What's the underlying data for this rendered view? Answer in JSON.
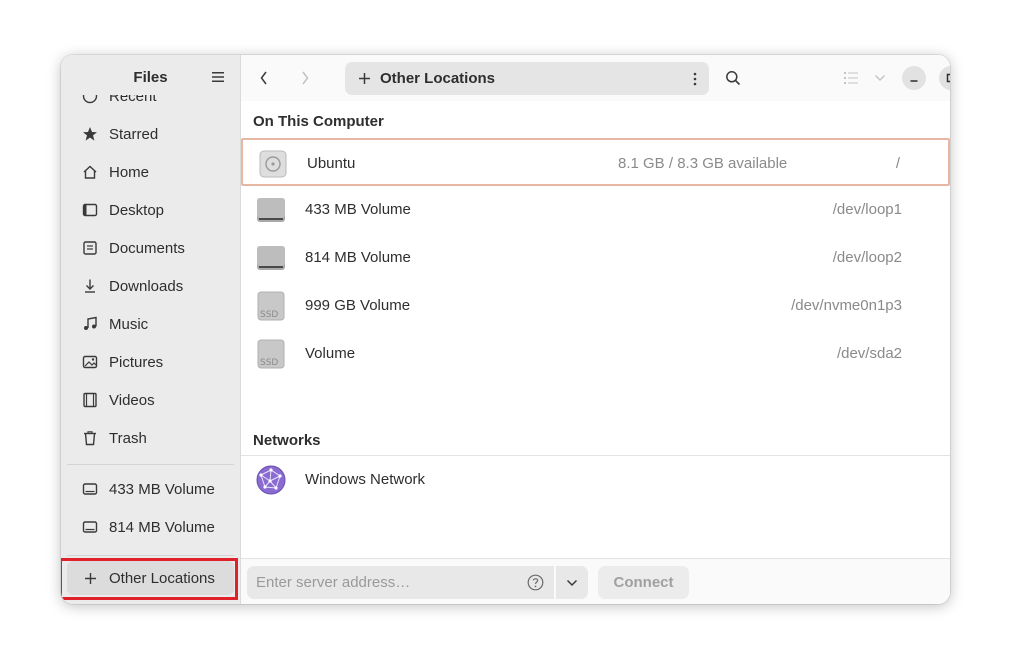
{
  "sidebar": {
    "title": "Files",
    "partial_top_item": "Recent",
    "items": [
      {
        "label": "Starred",
        "icon": "star-icon"
      },
      {
        "label": "Home",
        "icon": "home-icon"
      },
      {
        "label": "Desktop",
        "icon": "desktop-icon"
      },
      {
        "label": "Documents",
        "icon": "documents-icon"
      },
      {
        "label": "Downloads",
        "icon": "downloads-icon"
      },
      {
        "label": "Music",
        "icon": "music-icon"
      },
      {
        "label": "Pictures",
        "icon": "pictures-icon"
      },
      {
        "label": "Videos",
        "icon": "videos-icon"
      },
      {
        "label": "Trash",
        "icon": "trash-icon"
      }
    ],
    "volumes": [
      {
        "label": "433 MB Volume",
        "icon": "drive-icon"
      },
      {
        "label": "814 MB Volume",
        "icon": "drive-icon"
      }
    ],
    "other_locations": "Other Locations"
  },
  "header": {
    "path_label": "Other Locations"
  },
  "content": {
    "on_this_computer": "On This Computer",
    "devices": [
      {
        "name": "Ubuntu",
        "space": "8.1 GB / 8.3 GB available",
        "mount": "/",
        "icon": "disk-icon"
      },
      {
        "name": "433 MB Volume",
        "space": "",
        "mount": "/dev/loop1",
        "icon": "drive-icon"
      },
      {
        "name": "814 MB Volume",
        "space": "",
        "mount": "/dev/loop2",
        "icon": "drive-icon"
      },
      {
        "name": "999 GB Volume",
        "space": "",
        "mount": "/dev/nvme0n1p3",
        "icon": "ssd-icon"
      },
      {
        "name": "Volume",
        "space": "",
        "mount": "/dev/sda2",
        "icon": "ssd-icon"
      }
    ],
    "networks": "Networks",
    "network_items": [
      {
        "name": "Windows Network",
        "icon": "network-globe-icon"
      }
    ]
  },
  "footer": {
    "server_placeholder": "Enter server address…",
    "connect_label": "Connect"
  },
  "colors": {
    "accent_highlight": "#e0202a",
    "selected_row_border": "#e8b7a4"
  }
}
